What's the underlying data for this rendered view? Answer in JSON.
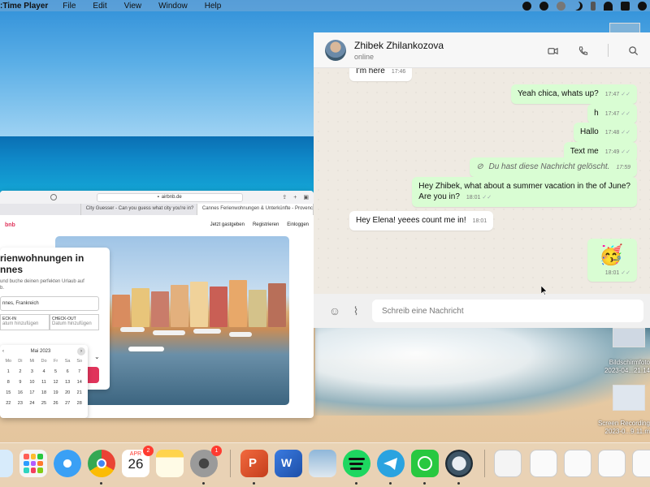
{
  "menubar": {
    "app_name": ":Time Player",
    "items": [
      "File",
      "Edit",
      "View",
      "Window",
      "Help"
    ]
  },
  "browser": {
    "url": "airbnb.de",
    "tabs": [
      "",
      "City Guesser - Can you guess what city you're in?",
      "Cannes Ferienwohnungen & Unterkünfte - Provence-Al..."
    ],
    "logo": "bnb",
    "nav_links": [
      "Jetzt gastgeben",
      "Registrieren",
      "Einloggen"
    ],
    "hero_title_1": "rienwohnungen in",
    "hero_title_2": "nnes",
    "hero_sub": "und buche deinen perfekten Urlaub auf",
    "hero_sub2": "b.",
    "location_value": "nnes, Frankreich",
    "checkin_label": "ECK-IN",
    "checkin_value": "atum hinzufügen",
    "checkout_label": "CHECK-OUT",
    "checkout_value": "Datum hinzufügen",
    "calendar": {
      "month": "Mai 2023",
      "weekdays": [
        "Mo",
        "Di",
        "Mi",
        "Do",
        "Fr",
        "Sa",
        "So"
      ],
      "days": [
        "1",
        "2",
        "3",
        "4",
        "5",
        "6",
        "7",
        "8",
        "9",
        "10",
        "11",
        "12",
        "13",
        "14",
        "15",
        "16",
        "17",
        "18",
        "19",
        "20",
        "21",
        "22",
        "23",
        "24",
        "25",
        "26",
        "27",
        "28"
      ]
    }
  },
  "whatsapp": {
    "contact_name": "Zhibek  Zhilankozova",
    "contact_status": "online",
    "messages": [
      {
        "text": "I'm here",
        "time": "17:46",
        "dir": "in"
      },
      {
        "text": "Yeah chica, whats up?",
        "time": "17:47",
        "dir": "out"
      },
      {
        "text": "h",
        "time": "17:47",
        "dir": "out"
      },
      {
        "text": "Hallo",
        "time": "17:48",
        "dir": "out"
      },
      {
        "text": "Text me",
        "time": "17:49",
        "dir": "out"
      },
      {
        "text": "Du hast diese Nachricht gelöscht.",
        "time": "17:59",
        "dir": "out"
      },
      {
        "text": "Hey Zhibek, what about a summer vacation in the of June?",
        "text2": "Are you in?",
        "time": "18:01",
        "dir": "out"
      },
      {
        "text": "Hey Elena! yeees count me in!",
        "time": "18:01",
        "dir": "in"
      },
      {
        "text": "🥳",
        "time": "18:01",
        "dir": "out"
      }
    ],
    "composer_placeholder": "Schreib eine Nachricht"
  },
  "desktop": {
    "files": [
      {
        "name": "Bildschirmfoto",
        "sub": "2023-04...21.14"
      },
      {
        "name": "Screen Recording",
        "sub": "2023-0...9.11.m"
      }
    ]
  },
  "dock": {
    "calendar_month": "APR",
    "calendar_day": "26",
    "calendar_badge": "2",
    "settings_badge": "1"
  }
}
